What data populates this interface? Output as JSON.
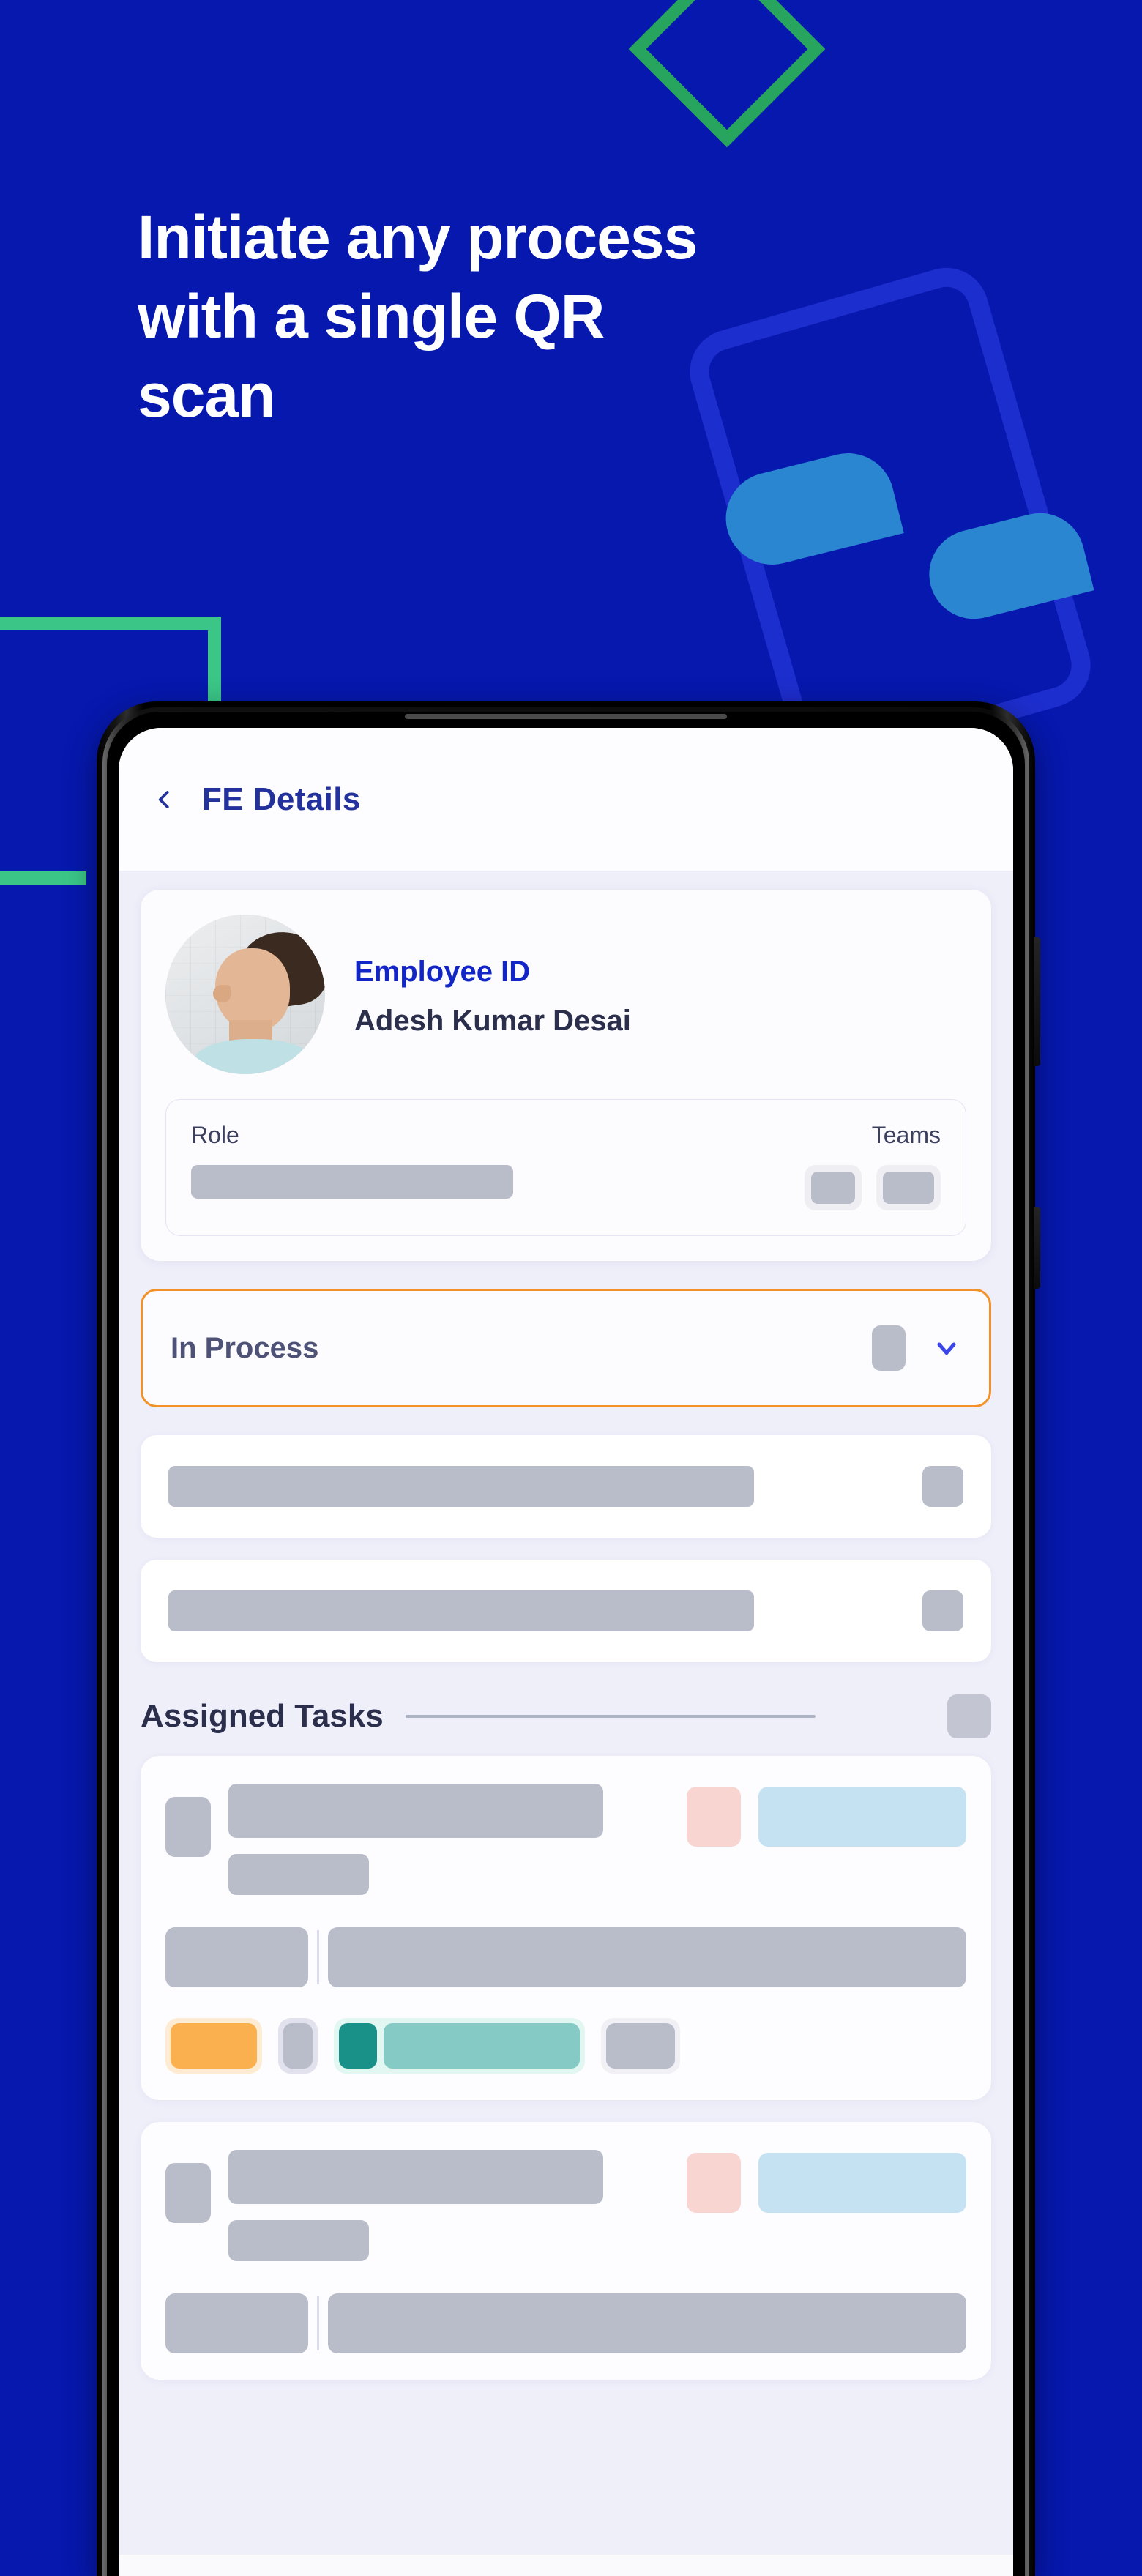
{
  "theme": {
    "background": "#0618AE",
    "accent_green": "#3BC687",
    "diamond_green": "#27A45E",
    "ghost_blue": "#2232D4",
    "blob_blue": "#2A86D0",
    "brand_blue": "#1226C8",
    "title_navy": "#22319B",
    "status_orange": "#F29128",
    "skeleton_grey": "#B9BCC9",
    "chip_orange": "#FBB050",
    "chip_teal_dark": "#199088",
    "chip_teal_light": "#85CAC4",
    "chip_pink": "#F9D5D2",
    "chip_blue": "#C5E2F3"
  },
  "promo": {
    "headline_lines": [
      "Initiate any process",
      "with a single QR",
      "scan"
    ]
  },
  "app": {
    "header": {
      "back_icon": "chevron-left-icon",
      "title": "FE Details"
    },
    "profile": {
      "avatar_icon": "user-avatar-photo",
      "employee_id_label": "Employee ID",
      "employee_name": "Adesh Kumar Desai",
      "role_label": "Role",
      "teams_label": "Teams"
    },
    "status": {
      "label": "In Process",
      "chevron_icon": "chevron-down-icon"
    },
    "tasks": {
      "section_title": "Assigned Tasks"
    }
  }
}
